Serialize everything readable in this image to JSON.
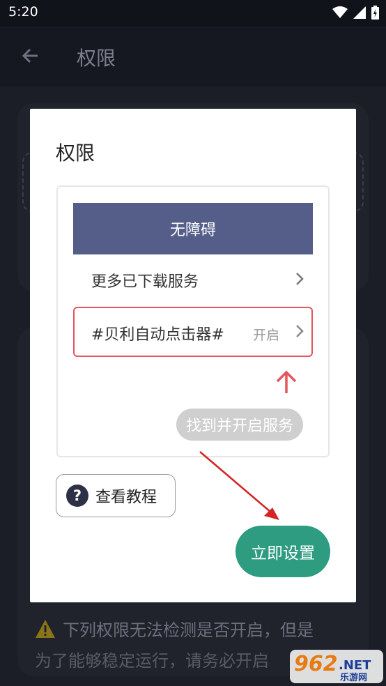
{
  "status_bar": {
    "time": "5:20"
  },
  "app_bar": {
    "title": "权限"
  },
  "background": {
    "warning_text": "下列权限无法检测是否开启，但是",
    "warning_text_2": "为了能够稳定运行，请务必开启"
  },
  "dialog": {
    "title": "权限",
    "illustration": {
      "header": "无障碍",
      "row_more_services": "更多已下载服务",
      "row_app_name": "#贝利自动点击器#",
      "row_app_status": "开启",
      "hint": "找到并开启服务"
    },
    "tutorial_button": "查看教程",
    "setup_button": "立即设置"
  },
  "watermark": {
    "brand": "962",
    "suffix": ".NET",
    "site": "乐游网"
  },
  "colors": {
    "accent_green": "#2e9c80",
    "header_blue": "#545e89",
    "highlight_red": "#e4555c",
    "backdrop": "#1b1e27"
  }
}
